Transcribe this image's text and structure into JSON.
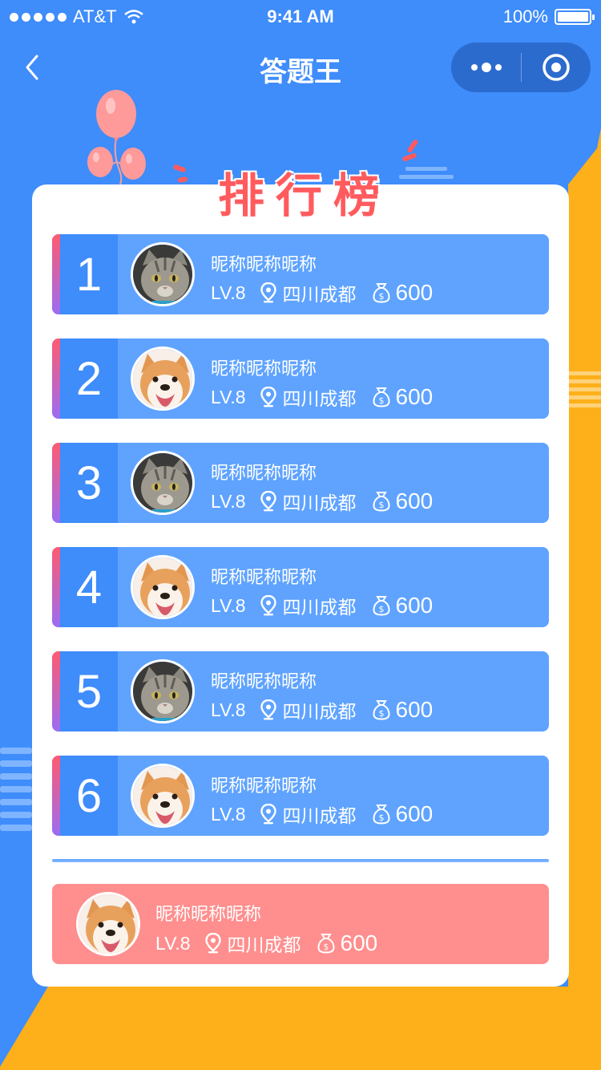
{
  "status_bar": {
    "carrier": "AT&T",
    "time": "9:41 AM",
    "battery": "100%"
  },
  "nav": {
    "title": "答题王"
  },
  "board": {
    "title": "排行榜"
  },
  "ranking": [
    {
      "rank": "1",
      "nickname": "昵称昵称昵称",
      "level": "LV.8",
      "location": "四川成都",
      "score": "600",
      "avatar": "cat"
    },
    {
      "rank": "2",
      "nickname": "昵称昵称昵称",
      "level": "LV.8",
      "location": "四川成都",
      "score": "600",
      "avatar": "dog"
    },
    {
      "rank": "3",
      "nickname": "昵称昵称昵称",
      "level": "LV.8",
      "location": "四川成都",
      "score": "600",
      "avatar": "cat"
    },
    {
      "rank": "4",
      "nickname": "昵称昵称昵称",
      "level": "LV.8",
      "location": "四川成都",
      "score": "600",
      "avatar": "dog"
    },
    {
      "rank": "5",
      "nickname": "昵称昵称昵称",
      "level": "LV.8",
      "location": "四川成都",
      "score": "600",
      "avatar": "cat"
    },
    {
      "rank": "6",
      "nickname": "昵称昵称昵称",
      "level": "LV.8",
      "location": "四川成都",
      "score": "600",
      "avatar": "dog"
    }
  ],
  "my_rank": {
    "nickname": "昵称昵称昵称",
    "level": "LV.8",
    "location": "四川成都",
    "score": "600",
    "avatar": "dog"
  },
  "colors": {
    "primary_blue": "#3f8cfb",
    "row_blue": "#5fa3ff",
    "accent_yellow": "#fdb01a",
    "title_red": "#ff5b5e",
    "my_row_pink": "#ff8e8e"
  },
  "icons": {
    "back": "chevron-left-icon",
    "more": "more-dots-icon",
    "close": "target-icon",
    "location": "location-pin-icon",
    "coin": "money-bag-icon"
  }
}
